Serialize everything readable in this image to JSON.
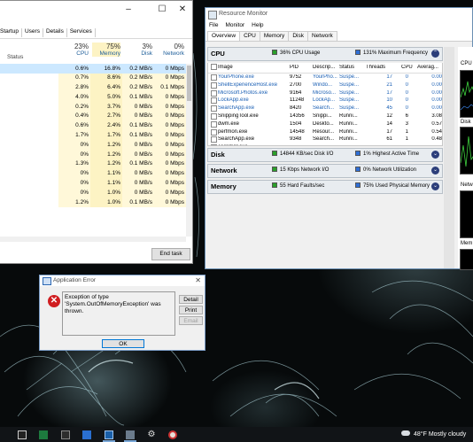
{
  "task_manager": {
    "tabs": [
      "Startup",
      "Users",
      "Details",
      "Services"
    ],
    "window_controls": [
      "–",
      "☐",
      "✕"
    ],
    "columns": [
      {
        "pct": "23%",
        "label": "CPU"
      },
      {
        "pct": "75%",
        "label": "Memory"
      },
      {
        "pct": "3%",
        "label": "Disk"
      },
      {
        "pct": "0%",
        "label": "Network"
      }
    ],
    "status_label": "Status",
    "sort_arrow": "∨",
    "rows": [
      {
        "cpu": "0.6%",
        "mem": "16.8%",
        "disk": "0.2 MB/s",
        "net": "0 Mbps"
      },
      {
        "cpu": "0.7%",
        "mem": "8.6%",
        "disk": "0.2 MB/s",
        "net": "0 Mbps"
      },
      {
        "cpu": "2.8%",
        "mem": "6.4%",
        "disk": "0.2 MB/s",
        "net": "0.1 Mbps"
      },
      {
        "cpu": "4.0%",
        "mem": "5.0%",
        "disk": "0.1 MB/s",
        "net": "0 Mbps"
      },
      {
        "cpu": "0.2%",
        "mem": "3.7%",
        "disk": "0 MB/s",
        "net": "0 Mbps"
      },
      {
        "cpu": "0.4%",
        "mem": "2.7%",
        "disk": "0 MB/s",
        "net": "0 Mbps"
      },
      {
        "cpu": "0.6%",
        "mem": "2.4%",
        "disk": "0.1 MB/s",
        "net": "0 Mbps"
      },
      {
        "cpu": "1.7%",
        "mem": "1.7%",
        "disk": "0.1 MB/s",
        "net": "0 Mbps"
      },
      {
        "cpu": "0%",
        "mem": "1.2%",
        "disk": "0 MB/s",
        "net": "0 Mbps"
      },
      {
        "cpu": "0%",
        "mem": "1.2%",
        "disk": "0 MB/s",
        "net": "0 Mbps"
      },
      {
        "cpu": "1.3%",
        "mem": "1.2%",
        "disk": "0.1 MB/s",
        "net": "0 Mbps"
      },
      {
        "cpu": "0%",
        "mem": "1.1%",
        "disk": "0 MB/s",
        "net": "0 Mbps"
      },
      {
        "cpu": "0%",
        "mem": "1.1%",
        "disk": "0 MB/s",
        "net": "0 Mbps"
      },
      {
        "cpu": "0%",
        "mem": "1.0%",
        "disk": "0 MB/s",
        "net": "0 Mbps"
      },
      {
        "cpu": "1.2%",
        "mem": "1.0%",
        "disk": "0.1 MB/s",
        "net": "0 Mbps"
      }
    ],
    "end_task_label": "End task"
  },
  "resource_monitor": {
    "title": "Resource Monitor",
    "menu": [
      "File",
      "Monitor",
      "Help"
    ],
    "tabs": [
      "Overview",
      "CPU",
      "Memory",
      "Disk",
      "Network"
    ],
    "cpu_section": {
      "name": "CPU",
      "stat1": "36% CPU Usage",
      "stat1_color": "#2aa02a",
      "stat2": "131% Maximum Frequency",
      "stat2_color": "#2f6fd6",
      "headers": [
        "Image",
        "PID",
        "Descrip...",
        "Status",
        "Threads",
        "CPU",
        "Averag..."
      ],
      "rows": [
        {
          "image": "YourPhone.exe",
          "pid": "9752",
          "desc": "YourPho...",
          "status": "Suspe...",
          "threads": "17",
          "cpu": "0",
          "avg": "0.00",
          "suspended": true
        },
        {
          "image": "ShellExperienceHost.exe",
          "pid": "2700",
          "desc": "Windo...",
          "status": "Suspe...",
          "threads": "21",
          "cpu": "0",
          "avg": "0.00",
          "suspended": true
        },
        {
          "image": "Microsoft.Photos.exe",
          "pid": "9164",
          "desc": "Microso...",
          "status": "Suspe...",
          "threads": "17",
          "cpu": "0",
          "avg": "0.00",
          "suspended": true
        },
        {
          "image": "LockApp.exe",
          "pid": "11248",
          "desc": "LockAp...",
          "status": "Suspe...",
          "threads": "10",
          "cpu": "0",
          "avg": "0.00",
          "suspended": true
        },
        {
          "image": "SearchApp.exe",
          "pid": "8420",
          "desc": "Search...",
          "status": "Suspe...",
          "threads": "45",
          "cpu": "0",
          "avg": "0.00",
          "suspended": true
        },
        {
          "image": "SnippingTool.exe",
          "pid": "14356",
          "desc": "Snippi...",
          "status": "Runni...",
          "threads": "12",
          "cpu": "6",
          "avg": "3.08",
          "suspended": false
        },
        {
          "image": "dwm.exe",
          "pid": "1504",
          "desc": "Deskto...",
          "status": "Runni...",
          "threads": "14",
          "cpu": "3",
          "avg": "0.57",
          "suspended": false
        },
        {
          "image": "perfmon.exe",
          "pid": "14548",
          "desc": "Resour...",
          "status": "Runni...",
          "threads": "17",
          "cpu": "1",
          "avg": "0.54",
          "suspended": false
        },
        {
          "image": "SearchApp.exe",
          "pid": "9348",
          "desc": "Search...",
          "status": "Runni...",
          "threads": "61",
          "cpu": "1",
          "avg": "0.48",
          "suspended": false
        },
        {
          "image": "Taskmgr.exe",
          "pid": "",
          "desc": "",
          "status": "",
          "threads": "",
          "cpu": "",
          "avg": "",
          "suspended": false
        }
      ]
    },
    "disk_section": {
      "name": "Disk",
      "stat1": "14844 KB/sec Disk I/O",
      "stat1_color": "#2aa02a",
      "stat2": "1% Highest Active Time",
      "stat2_color": "#2f6fd6"
    },
    "network_section": {
      "name": "Network",
      "stat1": "15 Kbps Network I/O",
      "stat1_color": "#2aa02a",
      "stat2": "0% Network Utilization",
      "stat2_color": "#2f6fd6"
    },
    "memory_section": {
      "name": "Memory",
      "stat1": "55 Hard Faults/sec",
      "stat1_color": "#2aa02a",
      "stat2": "75% Used Physical Memory",
      "stat2_color": "#2f6fd6"
    },
    "right_labels": [
      "CPU",
      "Disk",
      "Netw",
      "Mem"
    ]
  },
  "error_dialog": {
    "title": "Application Error",
    "message": "Exception of type 'System.OutOfMemoryException' was thrown.",
    "buttons": {
      "details": "Detail",
      "print": "Print",
      "email": "Email",
      "ok": "OK"
    }
  },
  "taskbar": {
    "icons": [
      "task-view-icon",
      "excel-icon",
      "calculator-icon",
      "photos-icon",
      "resource-monitor-icon",
      "application-icon",
      "settings-icon",
      "snipping-icon"
    ],
    "weather": {
      "temp": "48°F",
      "desc": "Mostly cloudy"
    }
  },
  "accents": {
    "memory_column_bg": "#fdf3c4",
    "cpu_column_bg": "#fff8d9",
    "rm_section_bg": "#e8ecf0"
  }
}
